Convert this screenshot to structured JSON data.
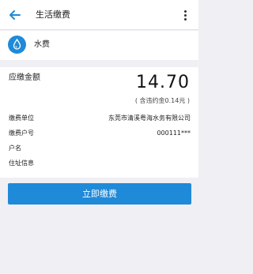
{
  "header": {
    "title": "生活缴费",
    "back_icon": "arrow-left-icon",
    "more_icon": "more-vertical-icon"
  },
  "service": {
    "name": "水费",
    "icon": "water-drop-icon",
    "icon_color": "#1f8ad8"
  },
  "bill": {
    "amount_label": "应缴金额",
    "amount": "14.70",
    "amount_note": "( 含违约金0.14元 )",
    "rows": [
      {
        "label": "缴费单位",
        "value": "东莞市清溪粤海水务有限公司"
      },
      {
        "label": "缴费户号",
        "value": "000111***"
      },
      {
        "label": "户名",
        "value": ""
      },
      {
        "label": "住址信息",
        "value": ""
      }
    ]
  },
  "actions": {
    "pay_label": "立即缴费",
    "accent_color": "#1f8ad8"
  }
}
